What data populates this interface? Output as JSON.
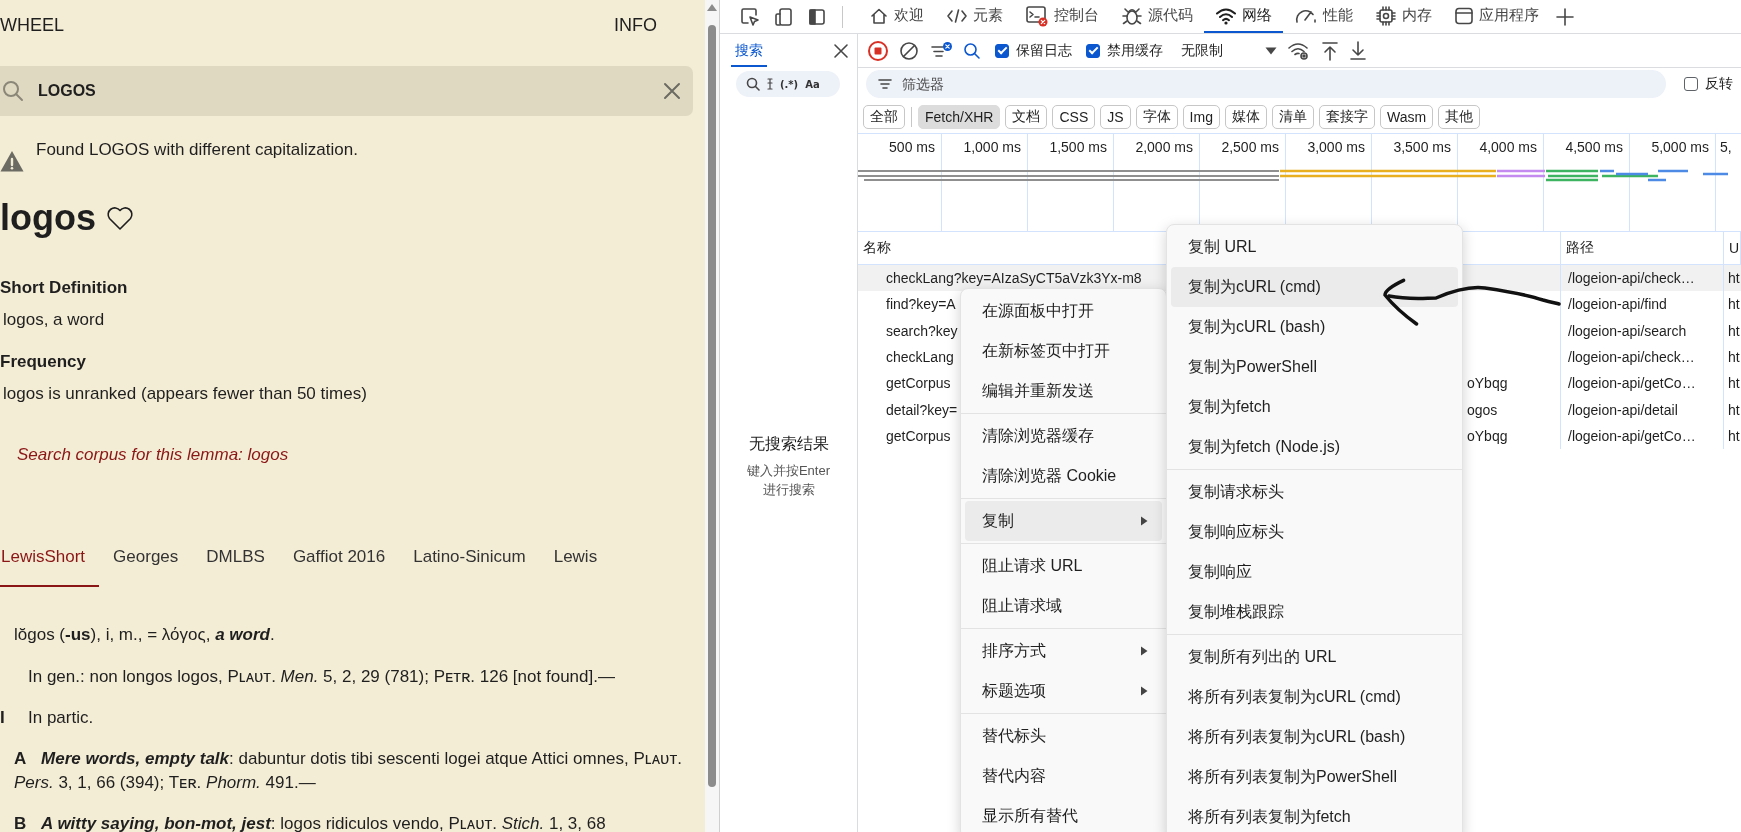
{
  "reader": {
    "top_links": [
      "WHEEL",
      "INFO"
    ],
    "search": {
      "value": "LOGOS"
    },
    "notice": "Found LOGOS with different capitalization.",
    "headword": "logos",
    "sections": [
      {
        "heading": "Short Definition",
        "text": "logos, a word"
      },
      {
        "heading": "Frequency",
        "text": "logos is unranked (appears fewer than 50 times)"
      }
    ],
    "corpus_link": "Search corpus for this lemma: logos",
    "tabs": [
      {
        "label": "LewisShort",
        "selected": true
      },
      {
        "label": "Georges",
        "selected": false
      },
      {
        "label": "DMLBS",
        "selected": false
      },
      {
        "label": "Gaffiot 2016",
        "selected": false
      },
      {
        "label": "Latino-Sinicum",
        "selected": false
      },
      {
        "label": "Lewis",
        "selected": false
      }
    ],
    "entry": [
      {
        "kind": "head",
        "text": "lŏgos (**-us**), i, m., = λόγος, **​*a word*​**."
      },
      {
        "kind": "sense",
        "text": "In gen.: non longos logos, Pʟᴀᴜᴛ. *Men.* 5, 2, 29 (781); Pᴇᴛʀ. 126 [not found].—"
      },
      {
        "kind": "sense",
        "label": "I",
        "text": "In partic."
      },
      {
        "kind": "subsense",
        "text": "**A** **​*Mere words, empty talk*​**: dabuntur dotis tibi sescenti logei atque Attici omnes, Pʟᴀᴜᴛ. *Pers.* 3, 1, 66 (394); Tᴇʀ. *Phorm.* 491.—"
      },
      {
        "kind": "subsense",
        "text": "**B** **​*A witty saying, bon-mot, jest*​**: logos ridiculos vendo, Pʟᴀᴜᴛ. *Stich.* 1, 3, 68"
      }
    ]
  },
  "devtools": {
    "panels": [
      {
        "label": "欢迎",
        "selected": false
      },
      {
        "label": "元素",
        "selected": false
      },
      {
        "label": "控制台",
        "selected": false
      },
      {
        "label": "源代码",
        "selected": false
      },
      {
        "label": "网络",
        "selected": true
      },
      {
        "label": "性能",
        "selected": false
      },
      {
        "label": "内存",
        "selected": false
      },
      {
        "label": "应用程序",
        "selected": false
      }
    ],
    "side": {
      "tab": {
        "label": "搜索",
        "selected": true
      },
      "search_options": [
        "(.*)",
        "Aa"
      ],
      "empty_title": "无搜索结果",
      "empty_hint": "键入并按Enter进行搜索"
    },
    "toolbar": {
      "checkboxes": [
        {
          "label": "保留日志",
          "checked": true
        },
        {
          "label": "禁用缓存",
          "checked": true
        }
      ],
      "throttling": "无限制"
    },
    "filter": {
      "placeholder": "筛选器"
    },
    "invert": {
      "label": "反转",
      "checked": false
    },
    "type_filters": [
      {
        "label": "全部",
        "selected": false
      },
      {
        "label": "Fetch/XHR",
        "selected": true
      },
      {
        "label": "文档",
        "selected": false
      },
      {
        "label": "CSS",
        "selected": false
      },
      {
        "label": "JS",
        "selected": false
      },
      {
        "label": "字体",
        "selected": false
      },
      {
        "label": "Img",
        "selected": false
      },
      {
        "label": "媒体",
        "selected": false
      },
      {
        "label": "清单",
        "selected": false
      },
      {
        "label": "套接字",
        "selected": false
      },
      {
        "label": "Wasm",
        "selected": false
      },
      {
        "label": "其他",
        "selected": false
      }
    ],
    "timeline": {
      "ticks": [
        "500 ms",
        "1,000 ms",
        "1,500 ms",
        "2,000 ms",
        "2,500 ms",
        "3,000 ms",
        "3,500 ms",
        "4,000 ms",
        "4,500 ms",
        "5,000 ms",
        "5,"
      ]
    },
    "table": {
      "columns": [
        "名称",
        "路径",
        "U"
      ],
      "rows": [
        {
          "name": "checkLang?key=AIzaSyCT5aVzk3Yx-m8",
          "path": "/logeion-api/check…",
          "column_3": "ht",
          "selected": true
        },
        {
          "name": "find?key=A",
          "path": "/logeion-api/find",
          "column_3": "ht",
          "selected": false
        },
        {
          "name": "search?key",
          "path": "/logeion-api/search",
          "column_3": "ht",
          "selected": false
        },
        {
          "name": "checkLang",
          "path": "/logeion-api/check…",
          "column_3": "ht",
          "selected": false
        },
        {
          "name": "getCorpus",
          "name_tail": "oYbqg",
          "path": "/logeion-api/getCo…",
          "column_3": "ht",
          "selected": false
        },
        {
          "name": "detail?key=",
          "name_tail": "ogos",
          "path": "/logeion-api/detail",
          "column_3": "ht",
          "selected": false
        },
        {
          "name": "getCorpus",
          "name_tail": "oYbqg",
          "path": "/logeion-api/getCo…",
          "column_3": "ht",
          "selected": false
        }
      ]
    },
    "context_menu": {
      "groups": [
        [
          {
            "label": "在源面板中打开",
            "highlighted": false
          },
          {
            "label": "在新标签页中打开",
            "highlighted": false
          },
          {
            "label": "编辑并重新发送",
            "highlighted": false
          }
        ],
        [
          {
            "label": "清除浏览器缓存",
            "highlighted": false
          },
          {
            "label": "清除浏览器 Cookie",
            "highlighted": false
          }
        ],
        [
          {
            "label": "复制",
            "highlighted": true,
            "submenu": true
          }
        ],
        [
          {
            "label": "阻止请求 URL",
            "highlighted": false
          },
          {
            "label": "阻止请求域",
            "highlighted": false
          }
        ],
        [
          {
            "label": "排序方式",
            "highlighted": false,
            "submenu": true
          },
          {
            "label": "标题选项",
            "highlighted": false,
            "submenu": true
          }
        ],
        [
          {
            "label": "替代标头",
            "highlighted": false
          },
          {
            "label": "替代内容",
            "highlighted": false
          },
          {
            "label": "显示所有替代",
            "highlighted": false
          }
        ]
      ]
    },
    "copy_submenu": {
      "groups": [
        [
          {
            "label": "复制 URL",
            "highlighted": false
          },
          {
            "label": "复制为cURL (cmd)",
            "highlighted": true
          },
          {
            "label": "复制为cURL (bash)",
            "highlighted": false
          },
          {
            "label": "复制为PowerShell",
            "highlighted": false
          },
          {
            "label": "复制为fetch",
            "highlighted": false
          },
          {
            "label": "复制为fetch (Node.js)",
            "highlighted": false
          }
        ],
        [
          {
            "label": "复制请求标头",
            "highlighted": false
          },
          {
            "label": "复制响应标头",
            "highlighted": false
          },
          {
            "label": "复制响应",
            "highlighted": false
          },
          {
            "label": "复制堆栈跟踪",
            "highlighted": false
          }
        ],
        [
          {
            "label": "复制所有列出的 URL",
            "highlighted": false
          },
          {
            "label": "将所有列表复制为cURL (cmd)",
            "highlighted": false
          },
          {
            "label": "将所有列表复制为cURL (bash)",
            "highlighted": false
          },
          {
            "label": "将所有列表复制为PowerShell",
            "highlighted": false
          },
          {
            "label": "将所有列表复制为fetch",
            "highlighted": false
          }
        ]
      ]
    }
  }
}
